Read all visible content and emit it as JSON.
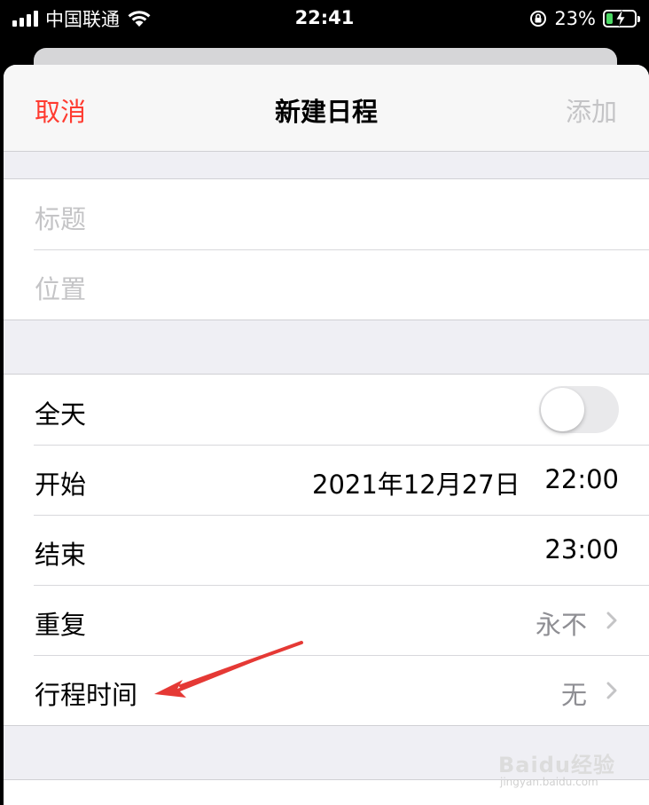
{
  "status_bar": {
    "carrier": "中国联通",
    "time": "22:41",
    "battery_percent": "23%",
    "battery_level": 0.23,
    "icons": [
      "signal-icon",
      "wifi-icon",
      "orientation-lock-icon",
      "battery-charging-icon"
    ]
  },
  "nav": {
    "cancel": "取消",
    "title": "新建日程",
    "add": "添加",
    "cancel_color": "#ff3b30"
  },
  "fields": {
    "title_placeholder": "标题",
    "location_placeholder": "位置"
  },
  "all_day": {
    "label": "全天",
    "enabled": false
  },
  "start": {
    "label": "开始",
    "date": "2021年12月27日",
    "time": "22:00"
  },
  "end": {
    "label": "结束",
    "time": "23:00"
  },
  "repeat": {
    "label": "重复",
    "value": "永不"
  },
  "travel_time": {
    "label": "行程时间",
    "value": "无"
  },
  "annotation": {
    "color": "#e53935"
  },
  "watermark": {
    "text": "Baidu经验",
    "sub": "jingyan.baidu.com"
  }
}
